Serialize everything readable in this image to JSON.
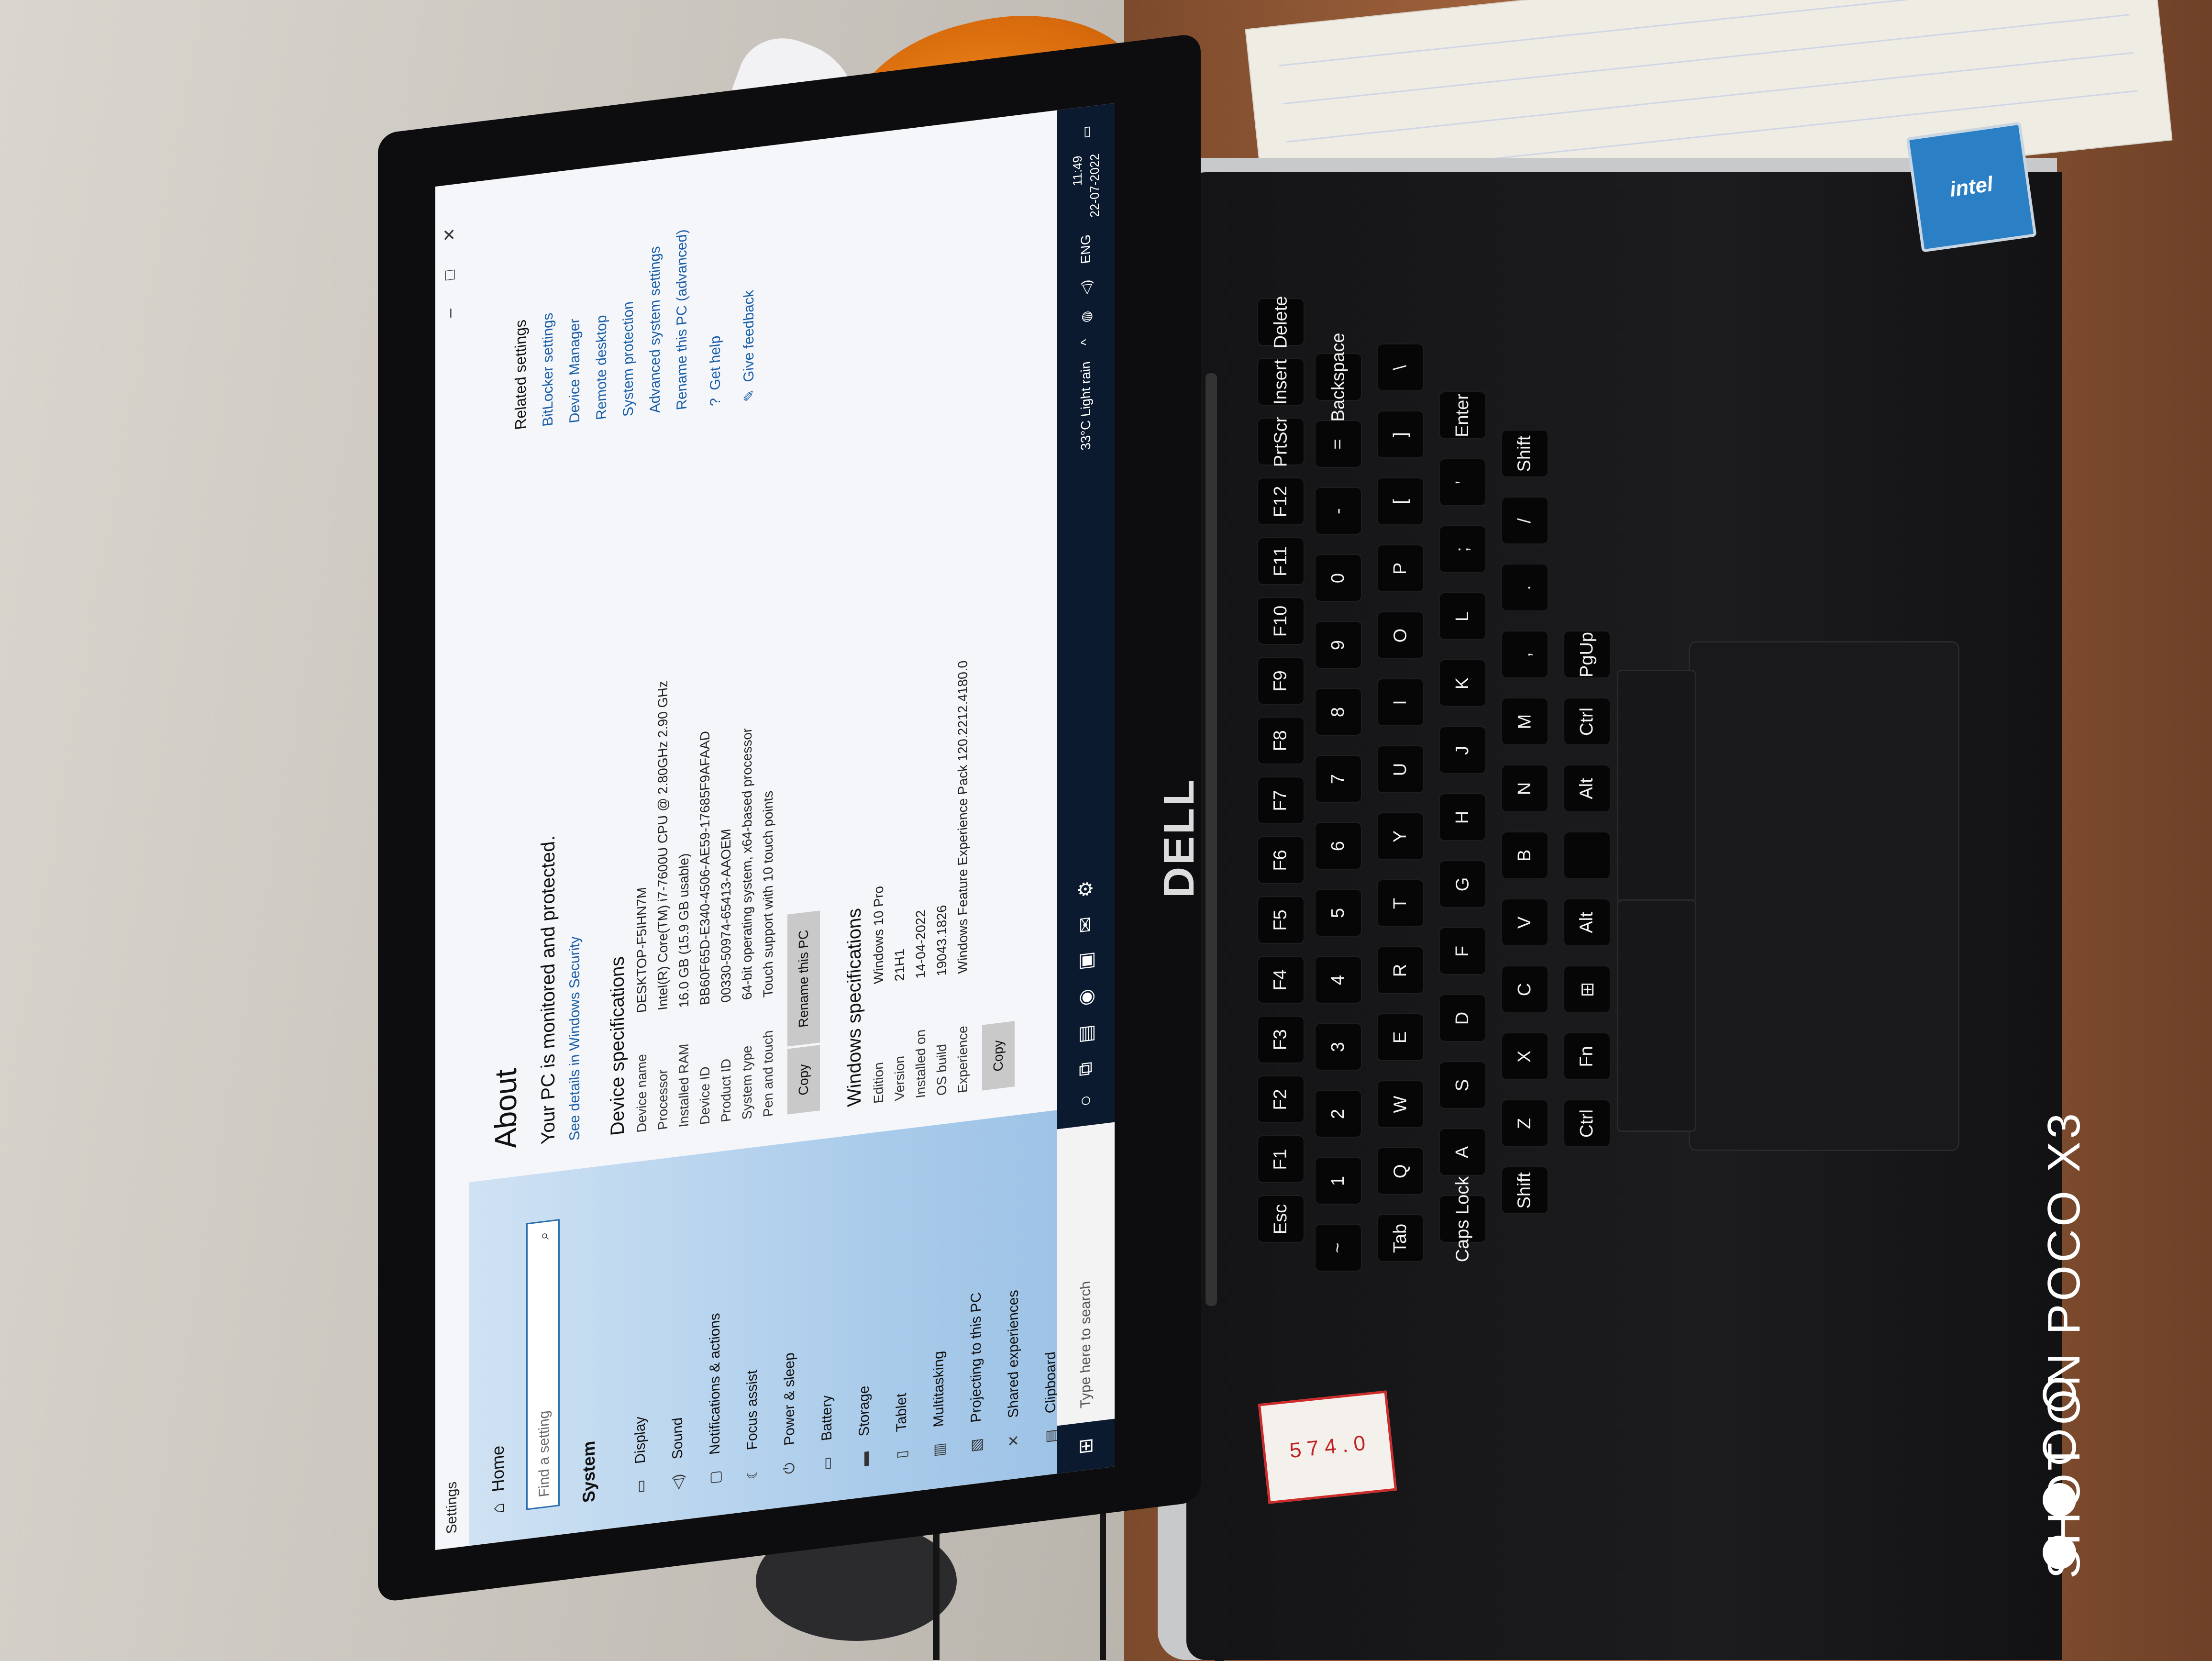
{
  "watermark": {
    "text": "SHOT ON POCO X3",
    "dot_colors": [
      "#ffffff",
      "#ffffff",
      "#ffffff",
      "#ffffff"
    ]
  },
  "laptop": {
    "brand_logo": "DELL",
    "intel_badge": "intel"
  },
  "window": {
    "title": "Settings",
    "controls": [
      "minimize-icon",
      "maximize-icon",
      "close-icon"
    ]
  },
  "sidebar": {
    "home": "Home",
    "search_placeholder": "Find a setting",
    "section": "System",
    "items": [
      {
        "icon": "display-icon",
        "label": "Display"
      },
      {
        "icon": "sound-icon",
        "label": "Sound"
      },
      {
        "icon": "notifications-icon",
        "label": "Notifications & actions"
      },
      {
        "icon": "focus-assist-icon",
        "label": "Focus assist"
      },
      {
        "icon": "power-icon",
        "label": "Power & sleep"
      },
      {
        "icon": "battery-icon",
        "label": "Battery"
      },
      {
        "icon": "storage-icon",
        "label": "Storage"
      },
      {
        "icon": "tablet-icon",
        "label": "Tablet"
      },
      {
        "icon": "multitasking-icon",
        "label": "Multitasking"
      },
      {
        "icon": "projecting-icon",
        "label": "Projecting to this PC"
      },
      {
        "icon": "shared-experiences-icon",
        "label": "Shared experiences"
      },
      {
        "icon": "clipboard-icon",
        "label": "Clipboard"
      }
    ]
  },
  "about": {
    "title": "About",
    "protected": "Your PC is monitored and protected.",
    "security_link": "See details in Windows Security",
    "device_spec_heading": "Device specifications",
    "device_specs": [
      {
        "k": "Device name",
        "v": "DESKTOP-F5IHN7M"
      },
      {
        "k": "Processor",
        "v": "Intel(R) Core(TM) i7-7600U CPU @ 2.80GHz   2.90 GHz"
      },
      {
        "k": "Installed RAM",
        "v": "16.0 GB (15.9 GB usable)"
      },
      {
        "k": "Device ID",
        "v": "BB60F65D-E340-4506-AE59-17685F9AFAAD"
      },
      {
        "k": "Product ID",
        "v": "00330-50974-65413-AAOEM"
      },
      {
        "k": "System type",
        "v": "64-bit operating system, x64-based processor"
      },
      {
        "k": "Pen and touch",
        "v": "Touch support with 10 touch points"
      }
    ],
    "copy_button": "Copy",
    "rename_button": "Rename this PC",
    "windows_spec_heading": "Windows specifications",
    "windows_specs": [
      {
        "k": "Edition",
        "v": "Windows 10 Pro"
      },
      {
        "k": "Version",
        "v": "21H1"
      },
      {
        "k": "Installed on",
        "v": "14-04-2022"
      },
      {
        "k": "OS build",
        "v": "19043.1826"
      },
      {
        "k": "Experience",
        "v": "Windows Feature Experience Pack 120.2212.4180.0"
      }
    ],
    "copy_button_2": "Copy"
  },
  "related": {
    "title": "Related settings",
    "links": [
      "BitLocker settings",
      "Device Manager",
      "Remote desktop",
      "System protection",
      "Advanced system settings",
      "Rename this PC (advanced)"
    ],
    "help": "Get help",
    "feedback": "Give feedback"
  },
  "taskbar": {
    "search_placeholder": "Type here to search",
    "weather": "33°C  Light rain",
    "language": "ENG",
    "time": "11:49",
    "date": "22-07-2022"
  },
  "sticker": {
    "text": "5 7 4 . 0"
  }
}
